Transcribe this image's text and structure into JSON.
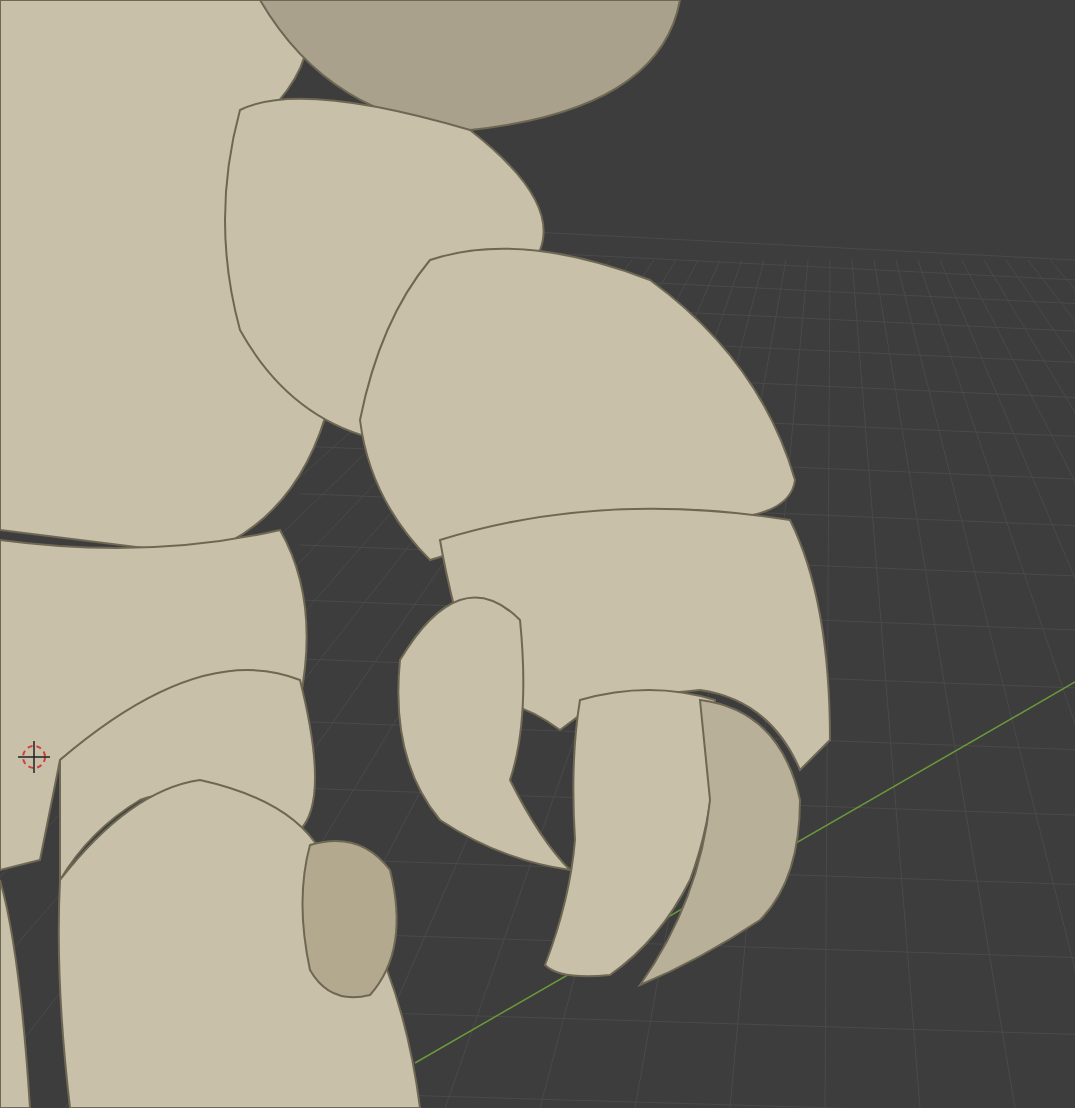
{
  "viewport": {
    "grid_visible": true,
    "x_axis_visible": true,
    "cursor_visible": true
  }
}
